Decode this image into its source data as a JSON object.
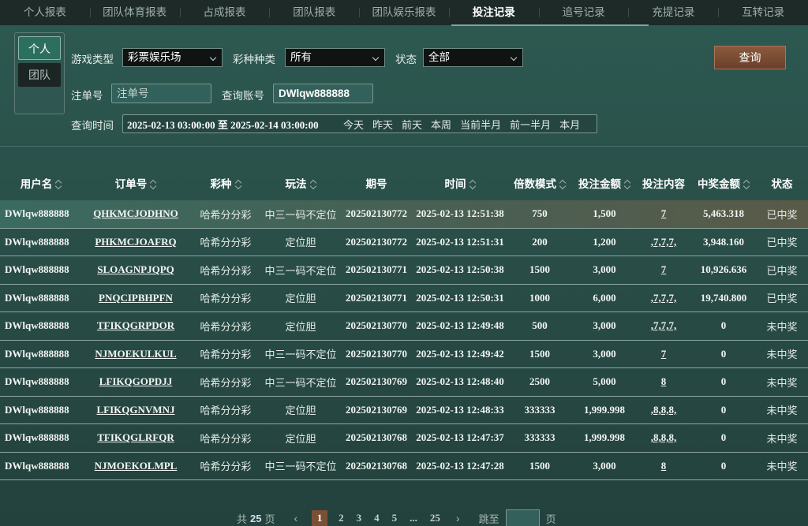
{
  "nav": {
    "tabs": [
      {
        "label": "个人报表"
      },
      {
        "label": "团队体育报表"
      },
      {
        "label": "占成报表"
      },
      {
        "label": "团队报表"
      },
      {
        "label": "团队娱乐报表"
      },
      {
        "label": "投注记录",
        "active": true
      },
      {
        "label": "追号记录"
      },
      {
        "label": "充提记录"
      },
      {
        "label": "互转记录"
      }
    ]
  },
  "filter": {
    "scope": {
      "personal": "个人",
      "team": "团队"
    },
    "game_type_label": "游戏类型",
    "game_type_value": "彩票娱乐场",
    "lottery_type_label": "彩种种类",
    "lottery_type_value": "所有",
    "status_label": "状态",
    "status_value": "全部",
    "order_no_label": "注单号",
    "order_no_placeholder": "注单号",
    "account_label": "查询账号",
    "account_value": "DWlqw888888",
    "time_label": "查询时间",
    "time_range": "2025-02-13 03:00:00 至 2025-02-14 03:00:00",
    "quick_ranges": [
      "今天",
      "昨天",
      "前天",
      "本周",
      "当前半月",
      "前一半月",
      "本月"
    ],
    "query_button": "查询"
  },
  "table": {
    "columns": [
      "用户名",
      "订单号",
      "彩种",
      "玩法",
      "期号",
      "时间",
      "倍数模式",
      "投注金额",
      "投注内容",
      "中奖金额",
      "状态"
    ],
    "rows": [
      [
        "DWlqw888888",
        "QHKMCJODHNO",
        "哈希分分彩",
        "中三一码不定位",
        "202502130772",
        "2025-02-13 12:51:38",
        "750",
        "1,500",
        "7",
        "5,463.318",
        "已中奖"
      ],
      [
        "DWlqw888888",
        "PHKMCJOAFRQ",
        "哈希分分彩",
        "定位胆",
        "202502130772",
        "2025-02-13 12:51:31",
        "200",
        "1,200",
        ",7,7,7,",
        "3,948.160",
        "已中奖"
      ],
      [
        "DWlqw888888",
        "SLOAGNPJQPQ",
        "哈希分分彩",
        "中三一码不定位",
        "202502130771",
        "2025-02-13 12:50:38",
        "1500",
        "3,000",
        "7",
        "10,926.636",
        "已中奖"
      ],
      [
        "DWlqw888888",
        "PNQCIPBHPFN",
        "哈希分分彩",
        "定位胆",
        "202502130771",
        "2025-02-13 12:50:31",
        "1000",
        "6,000",
        ",7,7,7,",
        "19,740.800",
        "已中奖"
      ],
      [
        "DWlqw888888",
        "TFIKQGRPDOR",
        "哈希分分彩",
        "定位胆",
        "202502130770",
        "2025-02-13 12:49:48",
        "500",
        "3,000",
        ",7,7,7,",
        "0",
        "未中奖"
      ],
      [
        "DWlqw888888",
        "NJMOEKULKUL",
        "哈希分分彩",
        "中三一码不定位",
        "202502130770",
        "2025-02-13 12:49:42",
        "1500",
        "3,000",
        "7",
        "0",
        "未中奖"
      ],
      [
        "DWlqw888888",
        "LFIKQGOPDJJ",
        "哈希分分彩",
        "中三一码不定位",
        "202502130769",
        "2025-02-13 12:48:40",
        "2500",
        "5,000",
        "8",
        "0",
        "未中奖"
      ],
      [
        "DWlqw888888",
        "LFIKQGNVMNJ",
        "哈希分分彩",
        "定位胆",
        "202502130769",
        "2025-02-13 12:48:33",
        "333333",
        "1,999.998",
        ",8,8,8,",
        "0",
        "未中奖"
      ],
      [
        "DWlqw888888",
        "TFIKQGLRFQR",
        "哈希分分彩",
        "定位胆",
        "202502130768",
        "2025-02-13 12:47:37",
        "333333",
        "1,999.998",
        ",8,8,8,",
        "0",
        "未中奖"
      ],
      [
        "DWlqw888888",
        "NJMOEKOLMPL",
        "哈希分分彩",
        "中三一码不定位",
        "202502130768",
        "2025-02-13 12:47:28",
        "1500",
        "3,000",
        "8",
        "0",
        "未中奖"
      ]
    ]
  },
  "pager": {
    "total_prefix": "共",
    "total_pages": "25",
    "total_suffix": "页",
    "prev": "‹",
    "pages": [
      "1",
      "2",
      "3",
      "4",
      "5",
      "...",
      "25"
    ],
    "next": "›",
    "jump_label": "跳至",
    "jump_suffix": "页"
  }
}
